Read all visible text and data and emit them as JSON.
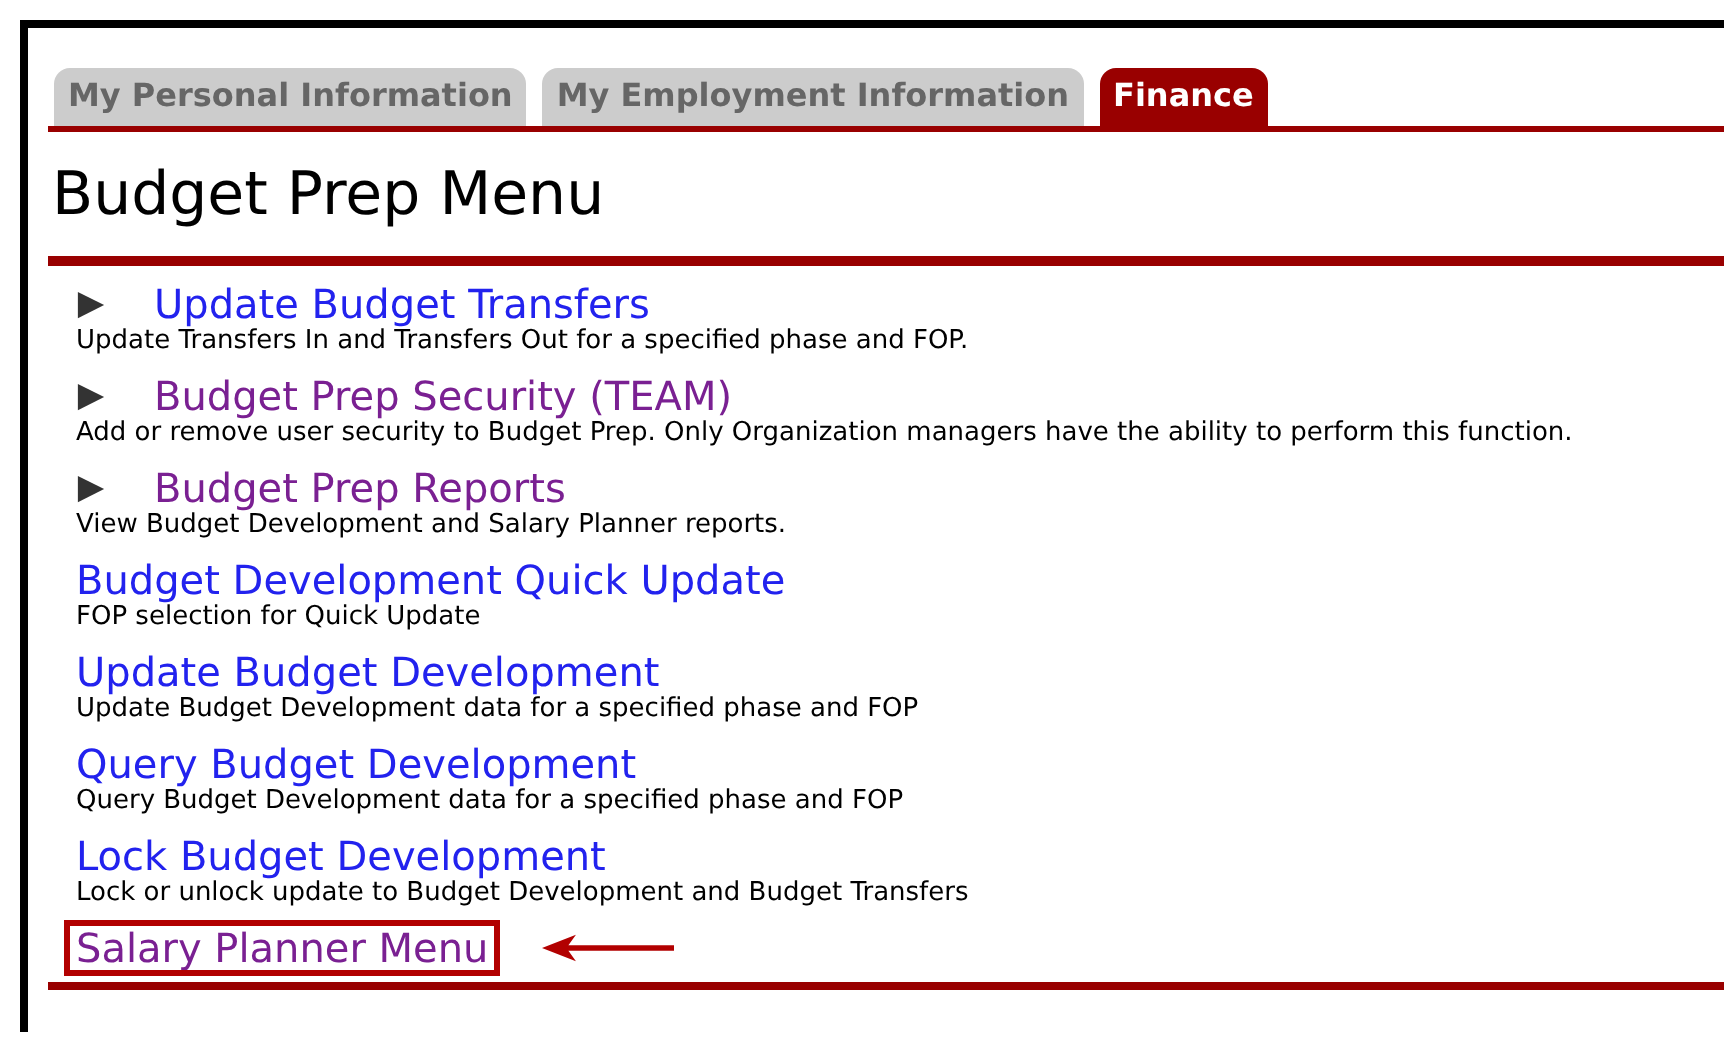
{
  "tabs": [
    {
      "label": "My Personal Information",
      "selected": false
    },
    {
      "label": "My Employment Information",
      "selected": false
    },
    {
      "label": "Finance",
      "selected": true
    }
  ],
  "page_title": "Budget Prep Menu",
  "menu_items": [
    {
      "kind": "submenu",
      "label": "Update Budget Transfers",
      "visited": false,
      "highlighted": false,
      "description": "Update Transfers In and Transfers Out for a specified phase and FOP."
    },
    {
      "kind": "submenu",
      "label": "Budget Prep Security (TEAM)",
      "visited": true,
      "highlighted": false,
      "description": "Add or remove user security to Budget Prep. Only Organization managers have the ability to perform this function."
    },
    {
      "kind": "submenu",
      "label": "Budget Prep Reports",
      "visited": true,
      "highlighted": false,
      "description": "View Budget Development and Salary Planner reports."
    },
    {
      "kind": "link",
      "label": "Budget Development Quick Update",
      "visited": false,
      "highlighted": false,
      "description": "FOP selection for Quick Update"
    },
    {
      "kind": "link",
      "label": "Update Budget Development",
      "visited": false,
      "highlighted": false,
      "description": "Update Budget Development data for a specified phase and FOP"
    },
    {
      "kind": "link",
      "label": "Query Budget Development",
      "visited": false,
      "highlighted": false,
      "description": "Query Budget Development data for a specified phase and FOP"
    },
    {
      "kind": "link",
      "label": "Lock Budget Development",
      "visited": false,
      "highlighted": false,
      "description": "Lock or unlock update to Budget Development and Budget Transfers"
    },
    {
      "kind": "link",
      "label": "Salary Planner Menu",
      "visited": true,
      "highlighted": true
    }
  ]
}
